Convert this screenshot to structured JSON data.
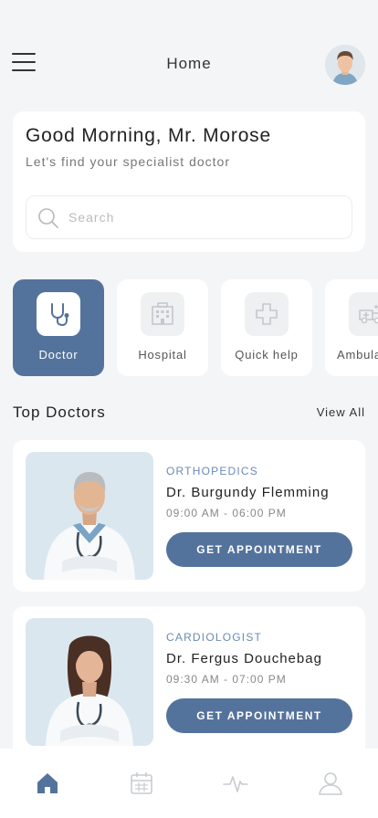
{
  "header": {
    "title": "Home",
    "menu_icon": "hamburger-menu-icon",
    "avatar_icon": "user-avatar"
  },
  "greeting": {
    "title": "Good Morning, Mr. Morose",
    "subtitle": "Let's find your specialist doctor"
  },
  "search": {
    "placeholder": "Search",
    "value": "",
    "icon": "search-icon"
  },
  "categories": [
    {
      "label": "Doctor",
      "icon": "stethoscope-icon",
      "active": true
    },
    {
      "label": "Hospital",
      "icon": "hospital-icon",
      "active": false
    },
    {
      "label": "Quick help",
      "icon": "medical-cross-icon",
      "active": false
    },
    {
      "label": "Ambula",
      "icon": "ambulance-icon",
      "active": false
    }
  ],
  "top_doctors": {
    "title": "Top Doctors",
    "view_all": "View All",
    "doctors": [
      {
        "specialty": "ORTHOPEDICS",
        "name": "Dr. Burgundy Flemming",
        "hours": "09:00 AM - 06:00 PM",
        "button": "GET APPOINTMENT"
      },
      {
        "specialty": "CARDIOLOGIST",
        "name": "Dr. Fergus Douchebag",
        "hours": "09:30 AM - 07:00 PM",
        "button": "GET APPOINTMENT"
      }
    ]
  },
  "tabbar": [
    {
      "icon": "home-icon",
      "active": true
    },
    {
      "icon": "calendar-icon",
      "active": false
    },
    {
      "icon": "activity-icon",
      "active": false
    },
    {
      "icon": "profile-icon",
      "active": false
    }
  ],
  "colors": {
    "accent": "#54739c",
    "background": "#f4f5f7",
    "card": "#ffffff"
  }
}
